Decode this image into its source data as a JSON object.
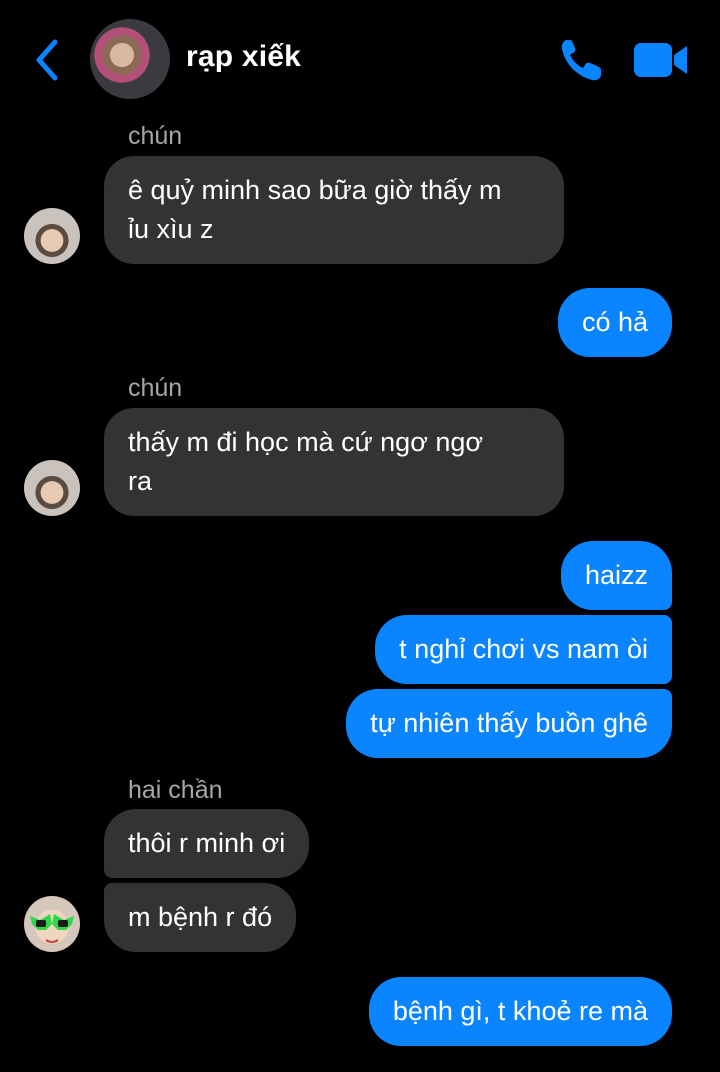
{
  "header": {
    "contact_name": "rạp xiếk"
  },
  "icons": {
    "back": "chevron-left-icon",
    "call": "phone-icon",
    "video": "video-camera-icon"
  },
  "colors": {
    "accent": "#0a84ff",
    "incoming_bubble": "#333335",
    "background": "#000000"
  },
  "messages": [
    {
      "sender": "chún",
      "lines": [
        "ê quỷ minh sao bữa giờ thấy m",
        "ỉu xìu z"
      ]
    },
    {
      "text": "có hả"
    },
    {
      "sender": "chún",
      "lines": [
        "thấy m đi học mà cứ ngơ ngơ",
        "ra"
      ]
    },
    {
      "text": "haizz"
    },
    {
      "text": "t nghỉ chơi vs nam òi"
    },
    {
      "text": "tự nhiên thấy buồn ghê"
    },
    {
      "sender": "hai chần",
      "text": "thôi r minh ơi"
    },
    {
      "text": "m bệnh r đó"
    },
    {
      "text": "bệnh gì, t khoẻ re mà"
    }
  ]
}
